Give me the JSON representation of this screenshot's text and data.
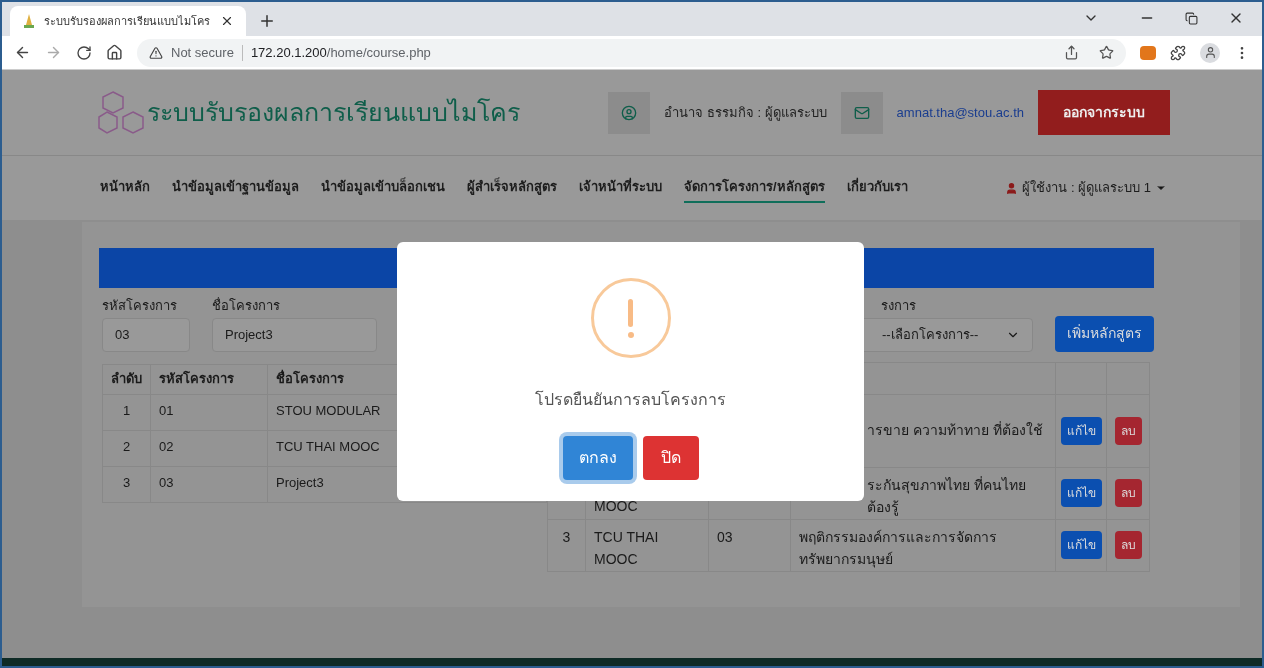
{
  "browser": {
    "tab_title": "ระบบรับรองผลการเรียนแบบไมโคร",
    "security": "Not secure",
    "url_host": "172.20.1.200",
    "url_path": "/home/course.php"
  },
  "header": {
    "site_title": "ระบบรับรองผลการเรียนแบบไมโคร",
    "user_name": "อำนาจ ธรรมกิจ : ผู้ดูแลระบบ",
    "email": "amnat.tha@stou.ac.th",
    "logout": "ออกจากระบบ"
  },
  "nav": {
    "items": [
      {
        "label": "หน้าหลัก",
        "selected": false
      },
      {
        "label": "นำข้อมูลเข้าฐานข้อมูล",
        "selected": false
      },
      {
        "label": "นำข้อมูลเข้าบล็อกเชน",
        "selected": false
      },
      {
        "label": "ผู้สำเร็จหลักสูตร",
        "selected": false
      },
      {
        "label": "เจ้าหน้าที่ระบบ",
        "selected": false
      },
      {
        "label": "จัดการโครงการ/หลักสูตร",
        "selected": true
      },
      {
        "label": "เกี่ยวกับเรา",
        "selected": false
      }
    ],
    "user_menu": "ผู้ใช้งาน : ผู้ดูแลระบบ 1"
  },
  "project_form": {
    "code_label": "รหัสโครงการ",
    "code_value": "03",
    "name_label": "ชื่อโครงการ",
    "name_value": "Project3"
  },
  "projects_table": {
    "columns": [
      "ลำดับ",
      "รหัสโครงการ",
      "ชื่อโครงการ"
    ],
    "rows": [
      [
        "1",
        "01",
        "STOU MODULAR"
      ],
      [
        "2",
        "02",
        "TCU THAI MOOC"
      ],
      [
        "3",
        "03",
        "Project3"
      ]
    ]
  },
  "course_form": {
    "select_label": "รงการ",
    "select_value": "--เลือกโครงการ--",
    "add_button": "เพิ่มหลักสูตร"
  },
  "courses_table": {
    "rows": [
      {
        "order": "",
        "project": "",
        "code": "",
        "course": "ารขาย ความท้าทาย ที่ต้องใช้",
        "covered": true,
        "edit": "แก้ไข",
        "delete": "ลบ"
      },
      {
        "order": "",
        "project": "MOOC",
        "code": "",
        "course": "ระกันสุขภาพไทย ที่คนไทยต้องรู้",
        "covered": true,
        "edit": "แก้ไข",
        "delete": "ลบ"
      },
      {
        "order": "3",
        "project": "TCU THAI MOOC",
        "code": "03",
        "course": "พฤติกรรมองค์การและการจัดการทรัพยากรมนุษย์",
        "covered": false,
        "edit": "แก้ไข",
        "delete": "ลบ"
      }
    ]
  },
  "dialog": {
    "message": "โปรดยืนยันการลบโครงการ",
    "confirm": "ตกลง",
    "close": "ปิด"
  }
}
